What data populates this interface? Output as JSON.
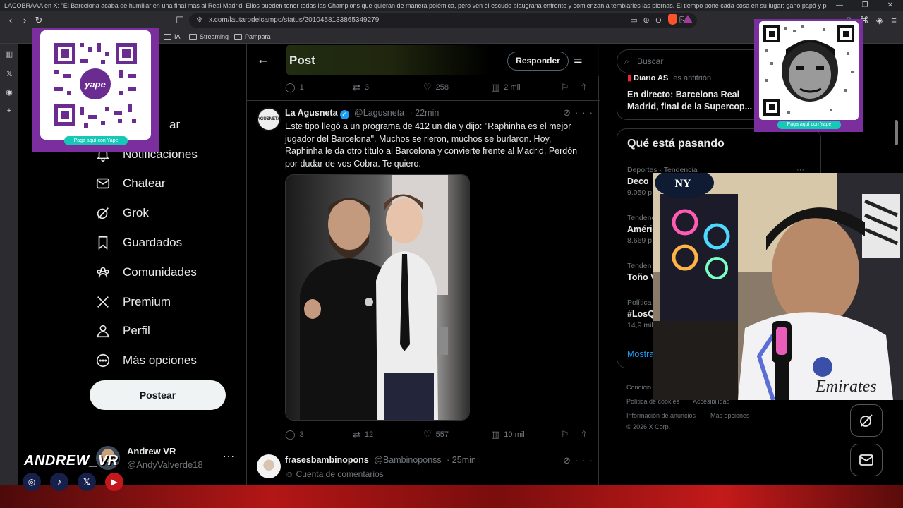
{
  "browser": {
    "window_title": "LACOBRAAA en X: \"El Barcelona acaba de humillar en una final más al Real Madrid. Ellos pueden tener todas las Champions que quieran de manera polémica, pero ven el escudo blaugrana enfrente y comienzan a temblarles las piernas. El tiempo pone cada cosa en su lugar: ganó papá y perdió su hijo.\" / X - Brave",
    "url": "x.com/lautarodelcampo/status/2010458133865349279",
    "bookmarks": [
      "IA",
      "Streaming",
      "Pampara"
    ]
  },
  "nav": {
    "items": [
      {
        "label": "Notificaciones",
        "icon": "bell-icon"
      },
      {
        "label": "Chatear",
        "icon": "mail-icon"
      },
      {
        "label": "Grok",
        "icon": "grok-icon"
      },
      {
        "label": "Guardados",
        "icon": "bookmark-icon"
      },
      {
        "label": "Comunidades",
        "icon": "communities-icon"
      },
      {
        "label": "Premium",
        "icon": "x-logo-icon"
      },
      {
        "label": "Perfil",
        "icon": "person-icon"
      },
      {
        "label": "Más opciones",
        "icon": "more-circle-icon"
      }
    ],
    "partial_label": "ar",
    "post_button": "Postear",
    "user": {
      "name": "Andrew VR",
      "handle": "@AndyValverde18"
    }
  },
  "post_view": {
    "header_title": "Post",
    "reply_button": "Responder",
    "parent_stats": {
      "replies": "1",
      "reposts": "3",
      "likes": "258",
      "views": "2 mil"
    },
    "tweet": {
      "author": "La Agusneta",
      "handle": "@Lagusneta",
      "time": "22min",
      "avatar_text": "AGUSNETA",
      "text": "Este tipo llegó a un programa de 412 un día y dijo: \"Raphinha es el mejor jugador del Barcelona\". Muchos se rieron, muchos se burlaron. Hoy, Raphinha le da otro título al Barcelona y convierte frente al Madrid. Perdón por dudar de vos Cobra. Te quiero.",
      "stats": {
        "replies": "3",
        "reposts": "12",
        "likes": "557",
        "views": "10 mil"
      }
    },
    "reply": {
      "author": "frasesbambinopons",
      "handle": "@Bambinoponss",
      "time": "25min",
      "subtitle": "Cuenta de comentarios"
    }
  },
  "sidebar": {
    "search_placeholder": "Buscar",
    "live": {
      "source": "Diario AS",
      "host": "es anfitrión",
      "title": "En directo: Barcelona Real Madrid, final de la Supercop..."
    },
    "trends_title": "Qué está pasando",
    "trends": [
      {
        "category": "Deportes · Tendencia",
        "name": "Deco",
        "count": "9.050 p"
      },
      {
        "category": "Tendenc",
        "name": "Améric",
        "count": "8.669 p"
      },
      {
        "category": "Tenden",
        "name": "Toño V",
        "count": ""
      },
      {
        "category": "Política",
        "name": "#LosQ",
        "count": "14,9 mil"
      }
    ],
    "show_more": "Mostra",
    "footer": [
      "Condicio",
      "Política de cookies",
      "Accesibilidad",
      "Información de anuncios",
      "Más opciones ···",
      "© 2026 X Corp."
    ]
  },
  "overlay": {
    "qr_left_label": "Paga aquí con Yape",
    "qr_left_brand": "yape",
    "qr_right_label": "Paga aquí con Yape",
    "streamer": "ANDREW_VR",
    "socials": [
      "instagram-icon",
      "tiktok-icon",
      "x-icon",
      "youtube-icon"
    ]
  }
}
